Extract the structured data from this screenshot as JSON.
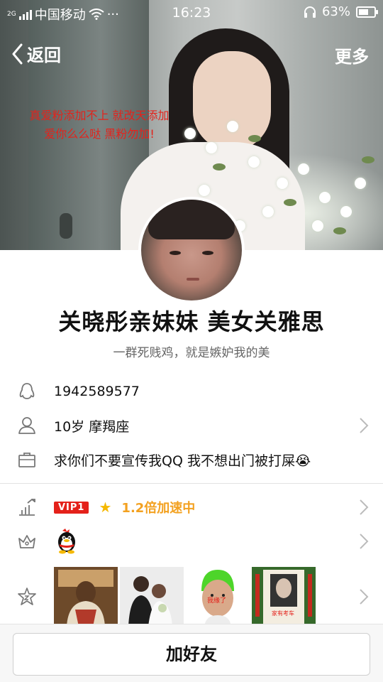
{
  "status_bar": {
    "network_type": "2G",
    "carrier": "中国移动",
    "dots": "···",
    "time": "16:23",
    "battery_percent": "63%",
    "battery_level": 0.63
  },
  "nav": {
    "back_label": "返回",
    "more_label": "更多"
  },
  "cover": {
    "caption_line1": "真爱粉添加不上 就改天添加",
    "caption_line2": "爱你么么哒 黑粉勿加!"
  },
  "profile": {
    "nickname": "关晓彤亲妹妹 美女关雅思",
    "signature": "一群死贱鸡，就是嫉妒我的美"
  },
  "info": {
    "qq_number": "1942589577",
    "age_zodiac": "10岁  摩羯座",
    "note": "求你们不要宣传我QQ 我不想出门被打屎",
    "note_emoji": "😭"
  },
  "vip": {
    "badge": "VIP1",
    "star": "★",
    "speed_text": "1.2倍加速中"
  },
  "photos": {
    "p3_caption": "我缘了",
    "p4_caption": "家有考车"
  },
  "bottom": {
    "add_friend_label": "加好友"
  },
  "colors": {
    "vip_red": "#e4211a",
    "speed_orange": "#f3a120",
    "caption_red": "#e3231c"
  }
}
